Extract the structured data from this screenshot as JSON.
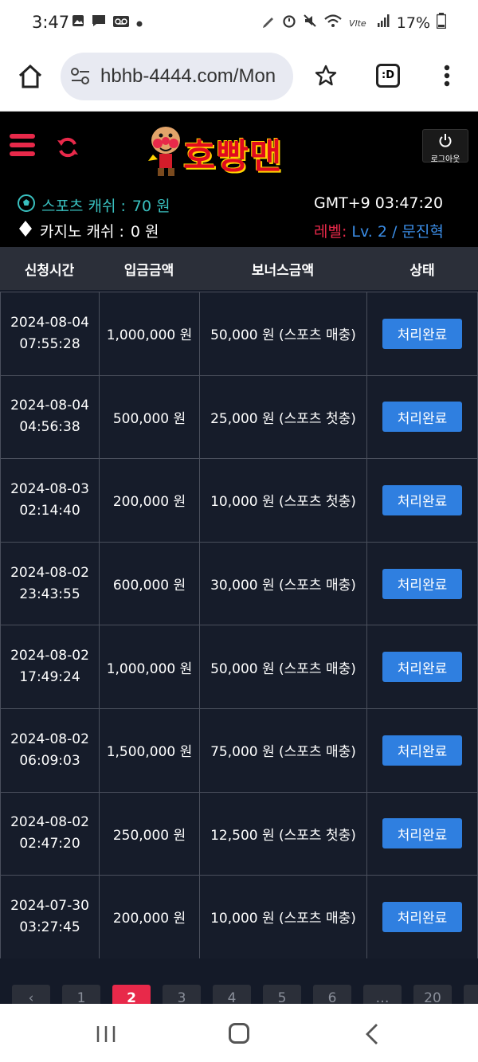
{
  "status_bar": {
    "time": "3:47",
    "battery_percent": "17%",
    "icons_left": [
      "image-icon",
      "message-icon",
      "voicemail-icon",
      "dot-icon"
    ],
    "icons_right": [
      "pen-icon",
      "alarm-icon",
      "mute-icon",
      "wifi-icon",
      "lte-icon",
      "signal-icon",
      "battery-icon"
    ]
  },
  "browser": {
    "url": "hbhb-4444.com/Mon",
    "tab_label": ":D"
  },
  "header": {
    "logo_text": "호빵맨",
    "logout_label": "로그아웃",
    "accent_color": "#e8294a"
  },
  "info": {
    "sports_cash_label": "스포츠 캐쉬 :",
    "sports_cash_value": "70 원",
    "casino_cash_label": "카지노 캐쉬 :",
    "casino_cash_value": "0 원",
    "clock": "GMT+9 03:47:20",
    "level_label": "레벨:",
    "level_value": "Lv. 2 / 문진혁"
  },
  "table": {
    "headers": [
      "신청시간",
      "입금금액",
      "보너스금액",
      "상태"
    ],
    "rows": [
      {
        "date": "2024-08-04",
        "time": "07:55:28",
        "deposit": "1,000,000 원",
        "bonus": "50,000 원 (스포츠 매충)",
        "status": "처리완료"
      },
      {
        "date": "2024-08-04",
        "time": "04:56:38",
        "deposit": "500,000 원",
        "bonus": "25,000 원 (스포츠 첫충)",
        "status": "처리완료"
      },
      {
        "date": "2024-08-03",
        "time": "02:14:40",
        "deposit": "200,000 원",
        "bonus": "10,000 원 (스포츠 첫충)",
        "status": "처리완료"
      },
      {
        "date": "2024-08-02",
        "time": "23:43:55",
        "deposit": "600,000 원",
        "bonus": "30,000 원 (스포츠 매충)",
        "status": "처리완료"
      },
      {
        "date": "2024-08-02",
        "time": "17:49:24",
        "deposit": "1,000,000 원",
        "bonus": "50,000 원 (스포츠 매충)",
        "status": "처리완료"
      },
      {
        "date": "2024-08-02",
        "time": "06:09:03",
        "deposit": "1,500,000 원",
        "bonus": "75,000 원 (스포츠 매충)",
        "status": "처리완료"
      },
      {
        "date": "2024-08-02",
        "time": "02:47:20",
        "deposit": "250,000 원",
        "bonus": "12,500 원 (스포츠 첫충)",
        "status": "처리완료"
      },
      {
        "date": "2024-07-30",
        "time": "03:27:45",
        "deposit": "200,000 원",
        "bonus": "10,000 원 (스포츠 매충)",
        "status": "처리완료"
      }
    ]
  },
  "pagination": {
    "items": [
      "‹",
      "1",
      "2",
      "3",
      "4",
      "5",
      "6",
      "…",
      "20",
      "›"
    ],
    "active": "2"
  }
}
